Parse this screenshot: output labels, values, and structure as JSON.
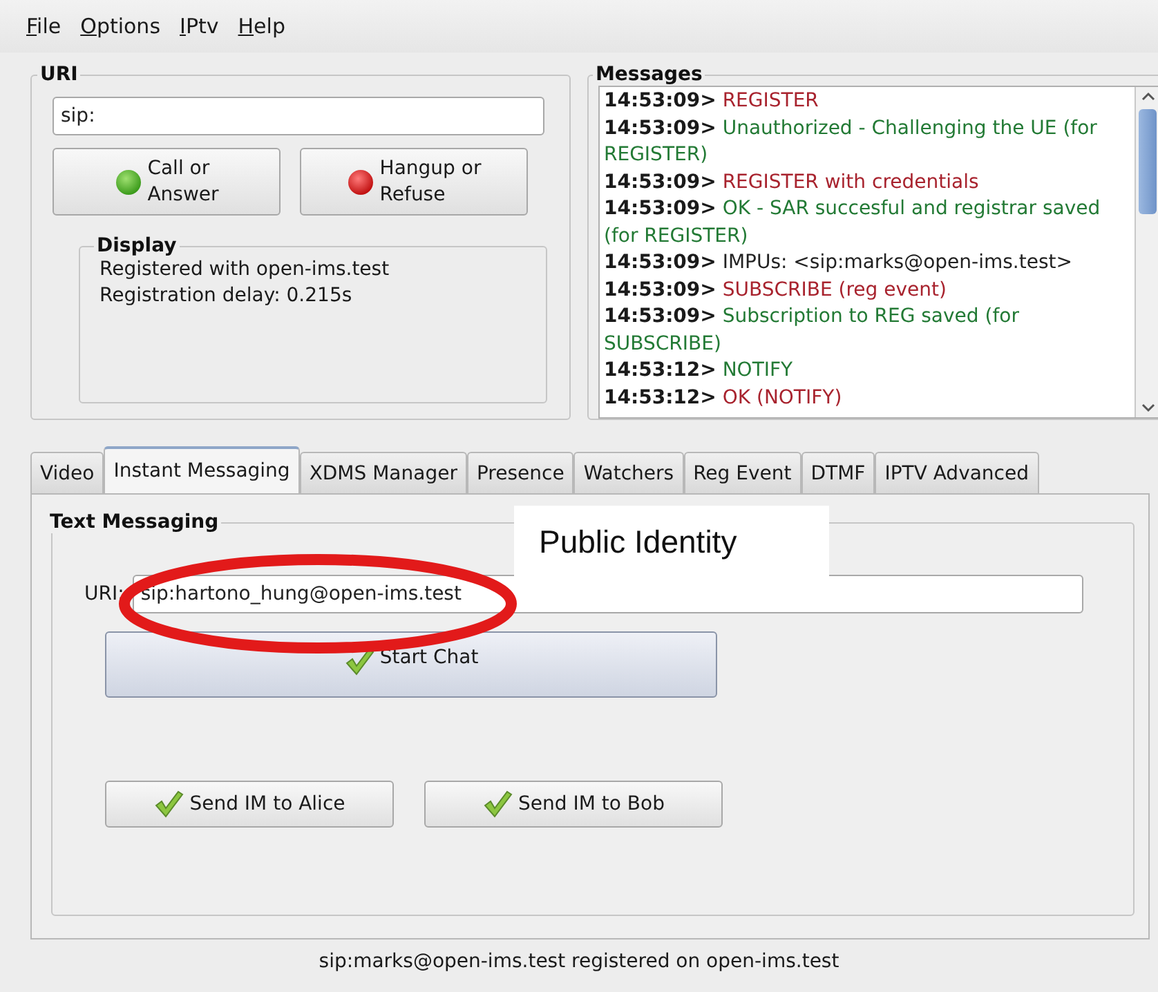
{
  "menu": [
    "File",
    "Options",
    "IPtv",
    "Help"
  ],
  "uri_panel": {
    "title": "URI",
    "uri_value": "sip:",
    "buttons": [
      {
        "label": "Call or\nAnswer",
        "kind": "call"
      },
      {
        "label": "Hangup or\nRefuse",
        "kind": "hangup"
      }
    ],
    "display": {
      "title": "Display",
      "lines": [
        "Registered with open-ims.test",
        "Registration delay: 0.215s"
      ]
    }
  },
  "messages": {
    "title": "Messages",
    "entries": [
      {
        "time": "14:53:09>",
        "text": "REGISTER",
        "color": "#a8232e"
      },
      {
        "time": "14:53:09>",
        "text": "Unauthorized - Challenging the UE (for REGISTER)",
        "color": "#237a35"
      },
      {
        "time": "14:53:09>",
        "text": "REGISTER with credentials",
        "color": "#a8232e"
      },
      {
        "time": "14:53:09>",
        "text": "OK - SAR succesful and registrar saved (for REGISTER)",
        "color": "#237a35"
      },
      {
        "time": "14:53:09>",
        "text": "IMPUs: <sip:marks@open-ims.test>",
        "color": "#222222"
      },
      {
        "time": "14:53:09>",
        "text": "SUBSCRIBE (reg event)",
        "color": "#a8232e"
      },
      {
        "time": "14:53:09>",
        "text": "Subscription to REG saved (for SUBSCRIBE)",
        "color": "#237a35"
      },
      {
        "time": "14:53:12>",
        "text": "NOTIFY",
        "color": "#237a35"
      },
      {
        "time": "14:53:12>",
        "text": "OK (NOTIFY)",
        "color": "#a8232e"
      }
    ]
  },
  "tabs": [
    {
      "label": "Video",
      "selected": false
    },
    {
      "label": "Instant Messaging",
      "selected": true
    },
    {
      "label": "XDMS Manager",
      "selected": false
    },
    {
      "label": "Presence",
      "selected": false
    },
    {
      "label": "Watchers",
      "selected": false
    },
    {
      "label": "Reg Event",
      "selected": false
    },
    {
      "label": "DTMF",
      "selected": false
    },
    {
      "label": "IPTV Advanced",
      "selected": false
    }
  ],
  "text_messaging": {
    "title": "Text Messaging",
    "uri_label": "URI:",
    "uri_value": "sip:hartono_hung@open-ims.test",
    "start_button": "Start Chat",
    "send_buttons": [
      "Send IM to Alice",
      "Send IM to Bob"
    ]
  },
  "annotation": {
    "callout": "Public Identity"
  },
  "status_bar": "sip:marks@open-ims.test registered on open-ims.test"
}
